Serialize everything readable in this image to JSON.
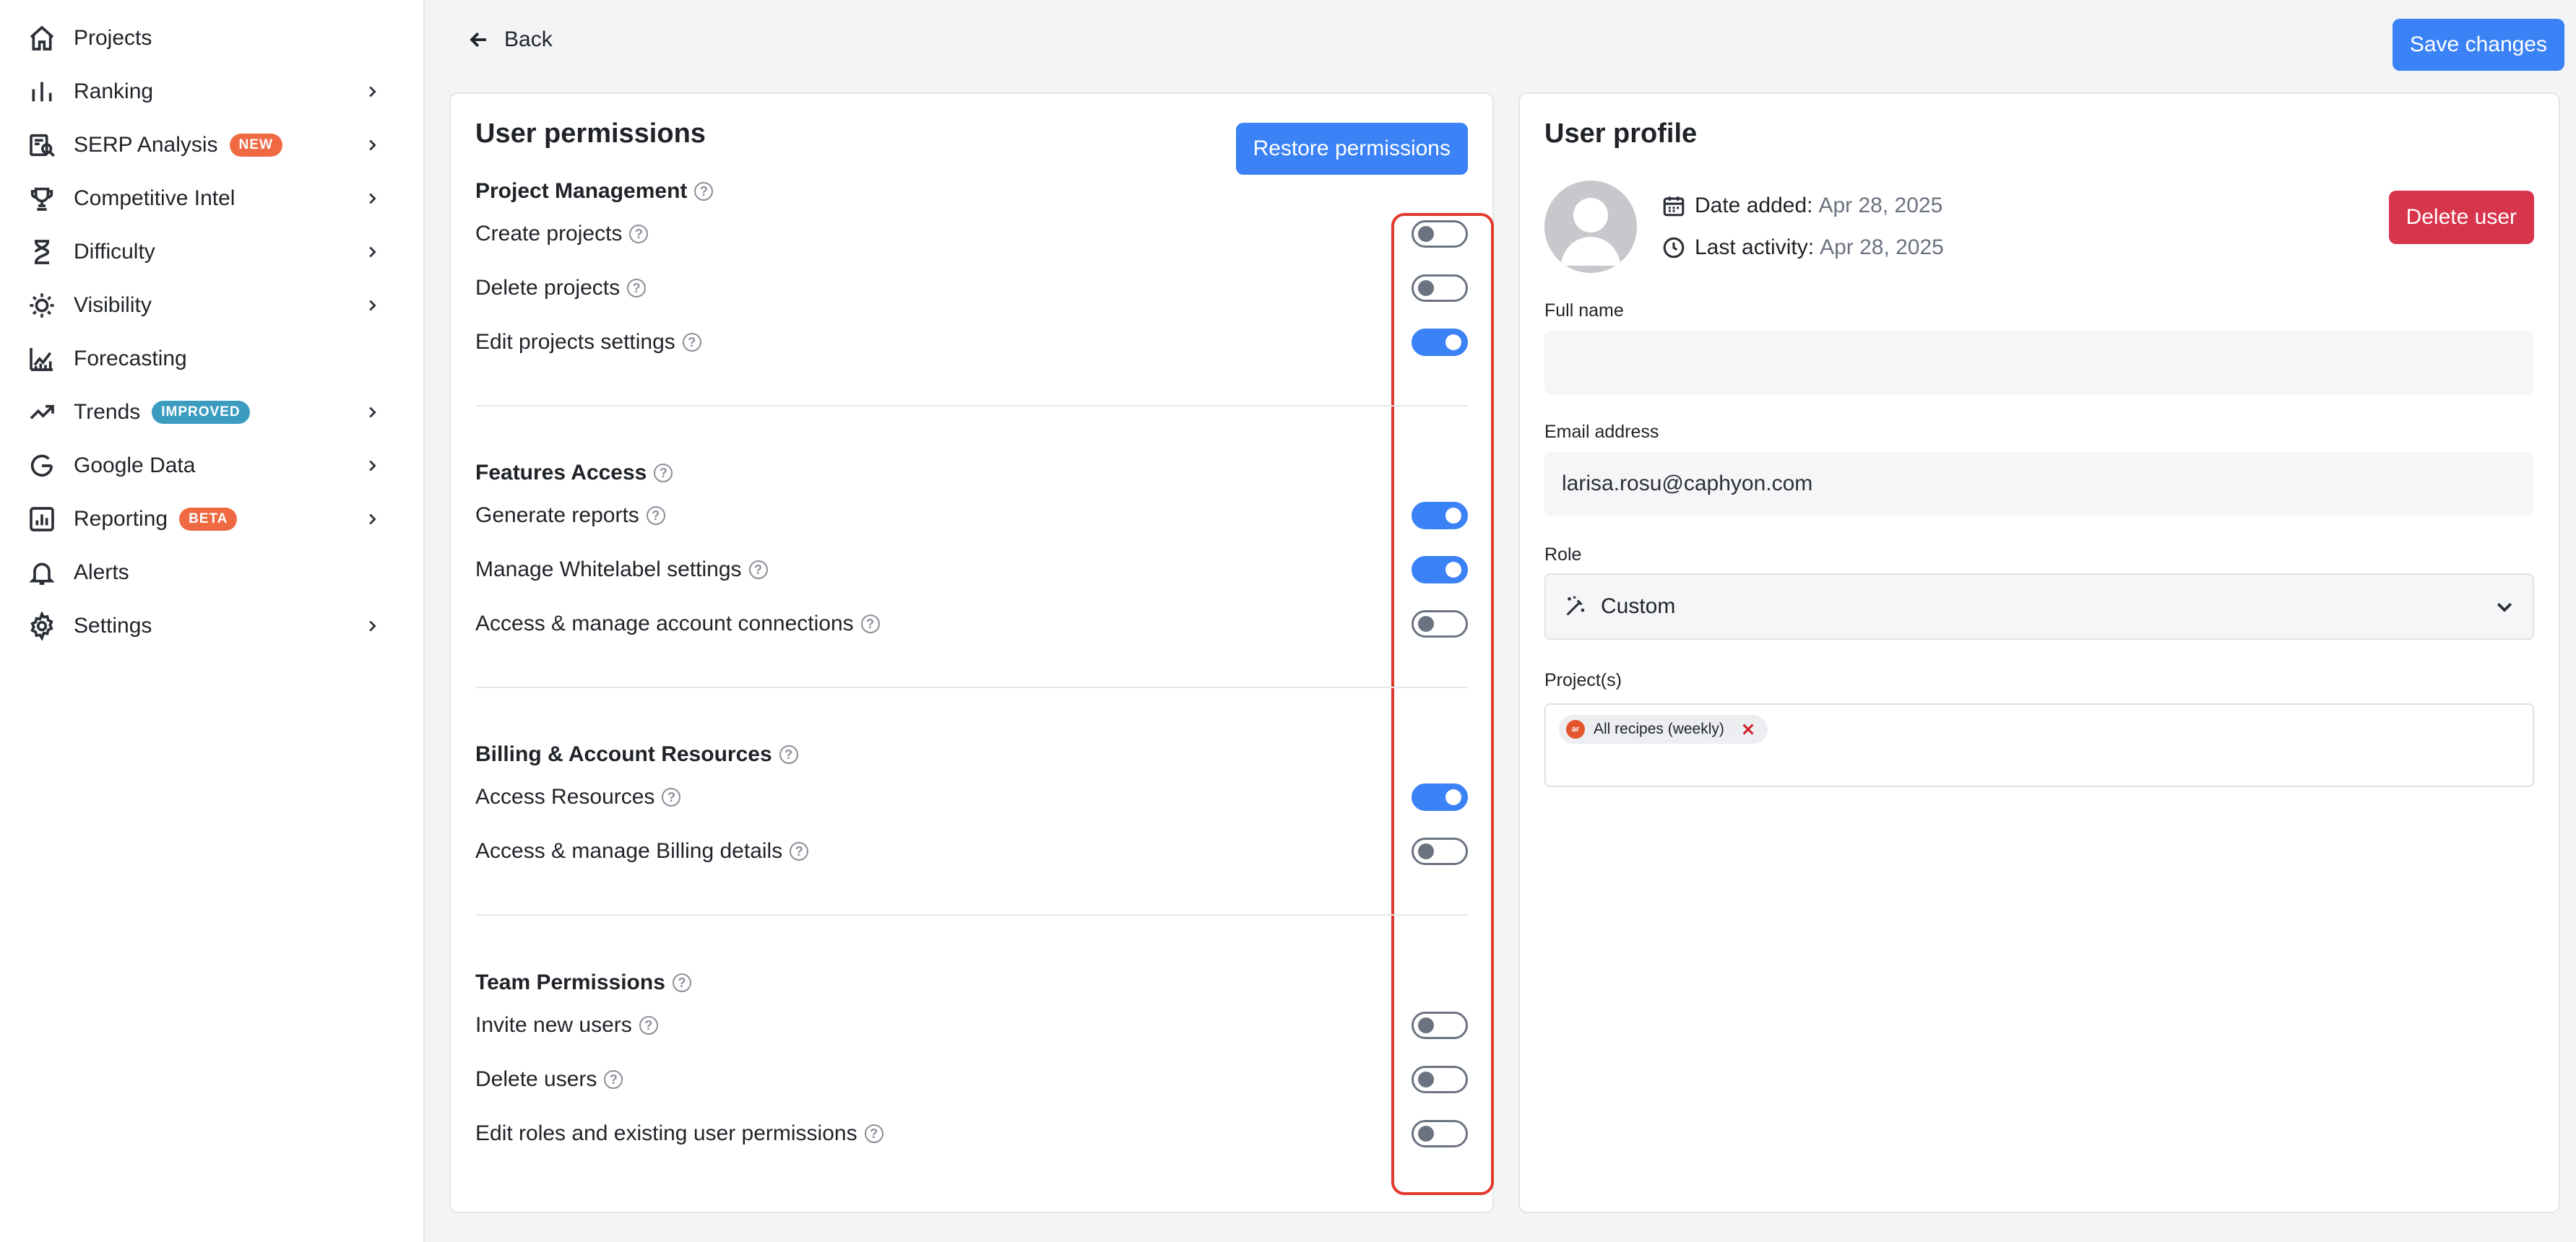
{
  "sidebar": {
    "items": [
      {
        "label": "Projects",
        "icon": "home-icon",
        "badge": null,
        "chevron": false
      },
      {
        "label": "Ranking",
        "icon": "bar-chart-icon",
        "badge": null,
        "chevron": true
      },
      {
        "label": "SERP Analysis",
        "icon": "serp-search-icon",
        "badge": {
          "text": "NEW",
          "color": "#ef6a43"
        },
        "chevron": true
      },
      {
        "label": "Competitive Intel",
        "icon": "trophy-icon",
        "badge": null,
        "chevron": true
      },
      {
        "label": "Difficulty",
        "icon": "hourglass-icon",
        "badge": null,
        "chevron": true
      },
      {
        "label": "Visibility",
        "icon": "sun-icon",
        "badge": null,
        "chevron": true
      },
      {
        "label": "Forecasting",
        "icon": "forecast-chart-icon",
        "badge": null,
        "chevron": false
      },
      {
        "label": "Trends",
        "icon": "trend-up-icon",
        "badge": {
          "text": "IMPROVED",
          "color": "#3c9cbf"
        },
        "chevron": true
      },
      {
        "label": "Google Data",
        "icon": "google-icon",
        "badge": null,
        "chevron": true
      },
      {
        "label": "Reporting",
        "icon": "report-icon",
        "badge": {
          "text": "BETA",
          "color": "#ef6a43"
        },
        "chevron": true
      },
      {
        "label": "Alerts",
        "icon": "bell-icon",
        "badge": null,
        "chevron": false
      },
      {
        "label": "Settings",
        "icon": "gear-icon",
        "badge": null,
        "chevron": true
      }
    ]
  },
  "header": {
    "back_label": "Back",
    "save_label": "Save changes"
  },
  "permissions": {
    "title": "User permissions",
    "restore_label": "Restore permissions",
    "sections": [
      {
        "title": "Project Management",
        "items": [
          {
            "label": "Create projects",
            "enabled": false
          },
          {
            "label": "Delete projects",
            "enabled": false
          },
          {
            "label": "Edit projects settings",
            "enabled": true
          }
        ]
      },
      {
        "title": "Features Access",
        "items": [
          {
            "label": "Generate reports",
            "enabled": true
          },
          {
            "label": "Manage Whitelabel settings",
            "enabled": true
          },
          {
            "label": "Access & manage account connections",
            "enabled": false
          }
        ]
      },
      {
        "title": "Billing & Account Resources",
        "items": [
          {
            "label": "Access Resources",
            "enabled": true
          },
          {
            "label": "Access & manage Billing details",
            "enabled": false
          }
        ]
      },
      {
        "title": "Team Permissions",
        "items": [
          {
            "label": "Invite new users",
            "enabled": false
          },
          {
            "label": "Delete users",
            "enabled": false
          },
          {
            "label": "Edit roles and existing user permissions",
            "enabled": false
          }
        ]
      }
    ]
  },
  "profile": {
    "title": "User profile",
    "date_added_label": "Date added:",
    "date_added_value": "Apr 28, 2025",
    "last_activity_label": "Last activity:",
    "last_activity_value": "Apr 28, 2025",
    "delete_label": "Delete user",
    "full_name_label": "Full name",
    "full_name_value": "",
    "email_label": "Email address",
    "email_value": "larisa.rosu@caphyon.com",
    "role_label": "Role",
    "role_value": "Custom",
    "projects_label": "Project(s)",
    "project_chip": "All recipes (weekly)",
    "project_chip_logo": "ar"
  },
  "colors": {
    "accent": "#3b82f6",
    "danger": "#d7354b",
    "highlight_border": "#e03a2f"
  }
}
